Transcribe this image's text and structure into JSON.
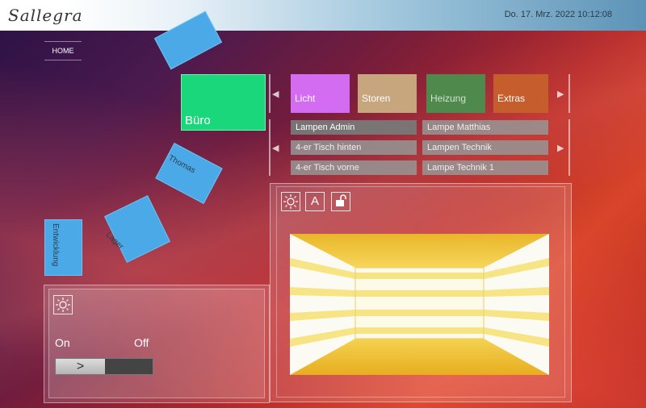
{
  "header": {
    "logo_text": "Sallegra",
    "datetime": "Do. 17. Mrz. 2022 10:12:08"
  },
  "nav": {
    "home_label": "HOME"
  },
  "rooms": {
    "selected": "Büro",
    "others": [
      "Thomas",
      "Lager",
      "Entwicklung"
    ]
  },
  "categories": [
    {
      "label": "Licht",
      "color": "#d46cf2"
    },
    {
      "label": "Storen",
      "color": "#c7a67e"
    },
    {
      "label": "Heizung",
      "color": "#4f8a4c"
    },
    {
      "label": "Extras",
      "color": "#c55d2d"
    }
  ],
  "lamps": [
    [
      "Lampen Admin",
      "Lampe Matthias"
    ],
    [
      "4-er Tisch hinten",
      "Lampen Technik"
    ],
    [
      "4-er Tisch vorne",
      "Lampe Technik 1"
    ]
  ],
  "room_panel": {
    "icons": [
      "brightness-icon",
      "auto-icon",
      "unlock-icon"
    ]
  },
  "light_panel": {
    "on_label": "On",
    "off_label": "Off",
    "knob_glyph": ">",
    "state": "on"
  },
  "colors": {
    "buero": "#19d77a",
    "room_tile": "#4aa9e6"
  }
}
